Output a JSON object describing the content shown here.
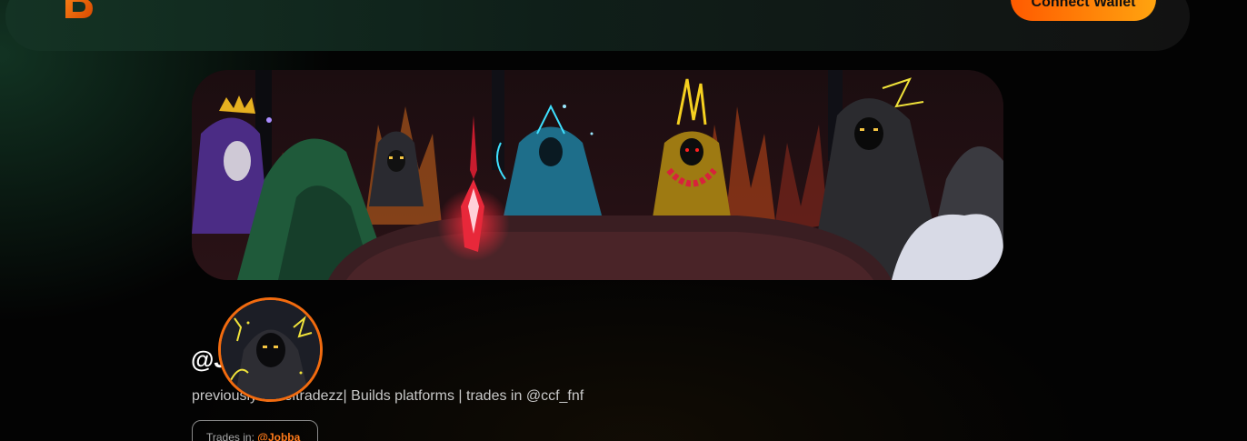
{
  "navbar": {
    "logo_icon": "brand-b-logo-icon",
    "connect_wallet_label": "Connect Wallet",
    "accent_gradient": [
      "#ff5a00",
      "#ffa40f"
    ]
  },
  "profile": {
    "banner_image": "hooded-council-pixel-art-banner",
    "avatar_image": "hooded-figure-pixel-art-avatar",
    "username": "@J",
    "bio": "previously @beltradezz| Builds platforms | trades in @ccf_fnf",
    "trades_in_label": "Trades in: ",
    "trades_in_handle": "@Jobba",
    "avatar_border_color": "#f26b0f"
  }
}
